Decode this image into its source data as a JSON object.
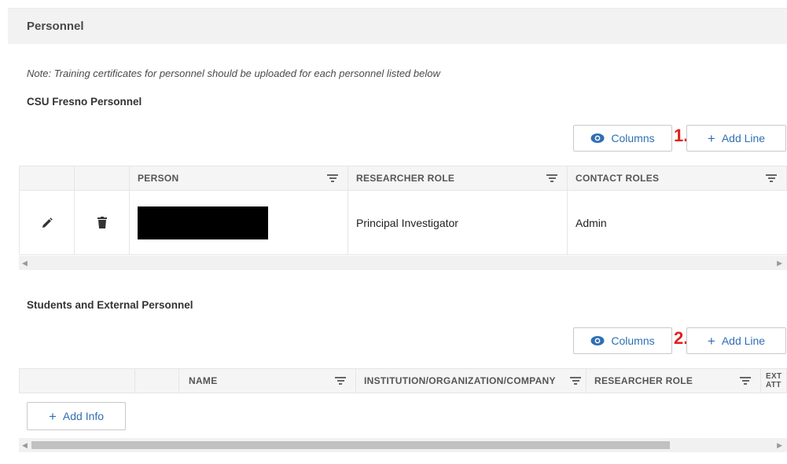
{
  "section": {
    "title": "Personnel"
  },
  "note": "Note: Training certificates for personnel should be uploaded for each personnel listed below",
  "csu": {
    "heading": "CSU Fresno Personnel",
    "columns_button": "Columns",
    "add_line_button": "Add Line",
    "marker": "1.",
    "headers": [
      "PERSON",
      "RESEARCHER ROLE",
      "CONTACT ROLES"
    ],
    "rows": [
      {
        "person": "",
        "researcher_role": "Principal Investigator",
        "contact_roles": "Admin"
      }
    ]
  },
  "students": {
    "heading": "Students and External Personnel",
    "columns_button": "Columns",
    "add_line_button": "Add Line",
    "marker": "2.",
    "headers": [
      "NAME",
      "INSTITUTION/ORGANIZATION/COMPANY",
      "RESEARCHER ROLE",
      "EXT ATT"
    ],
    "add_info_button": "Add Info"
  },
  "icons": {
    "edit": "pencil-icon",
    "delete": "trash-icon",
    "columns": "eye-icon",
    "filter": "filter-icon",
    "add": "plus-icon"
  },
  "colors": {
    "accent": "#2f6fb2",
    "marker": "#e02020",
    "header_bg": "#f2f2f2"
  }
}
